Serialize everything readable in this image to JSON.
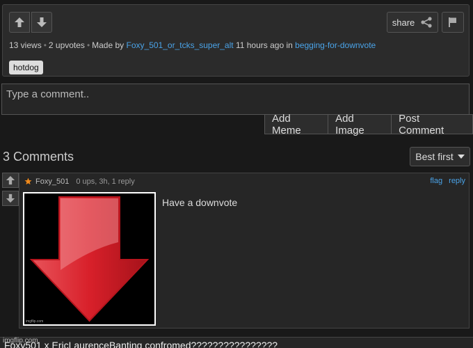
{
  "post": {
    "views": "13 views",
    "upvotes": "2 upvotes",
    "made_by_prefix": "Made by",
    "author": "Foxy_501_or_tcks_super_alt",
    "time_ago": "11 hours ago in",
    "stream": "begging-for-downvote",
    "tag": "hotdog",
    "share_label": "share"
  },
  "comment_box": {
    "placeholder": "Type a comment..",
    "buttons": [
      "Add Meme",
      "Add Image",
      "Post Comment"
    ]
  },
  "comments_header": {
    "count_label": "3 Comments",
    "sort_label": "Best first"
  },
  "comments": [
    {
      "username": "Foxy_501",
      "stats": "0 ups, 3h, 1 reply",
      "flag_label": "flag",
      "reply_label": "reply",
      "text": "Have a downvote",
      "image_watermark": "imgflip.com"
    }
  ],
  "next_comment": {
    "watermark": "imgflip.com",
    "text": "Foxy501 x EricLaurenceBanting confromed????????????????"
  },
  "icons": [
    "upvote-arrow-icon",
    "downvote-arrow-icon",
    "share-icon",
    "flag-icon",
    "caret-down-icon",
    "star-icon",
    "red-down-arrow-icon"
  ],
  "colors": {
    "background": "#191919",
    "link": "#4aa3e8",
    "arrow_red": "#d8202a"
  }
}
